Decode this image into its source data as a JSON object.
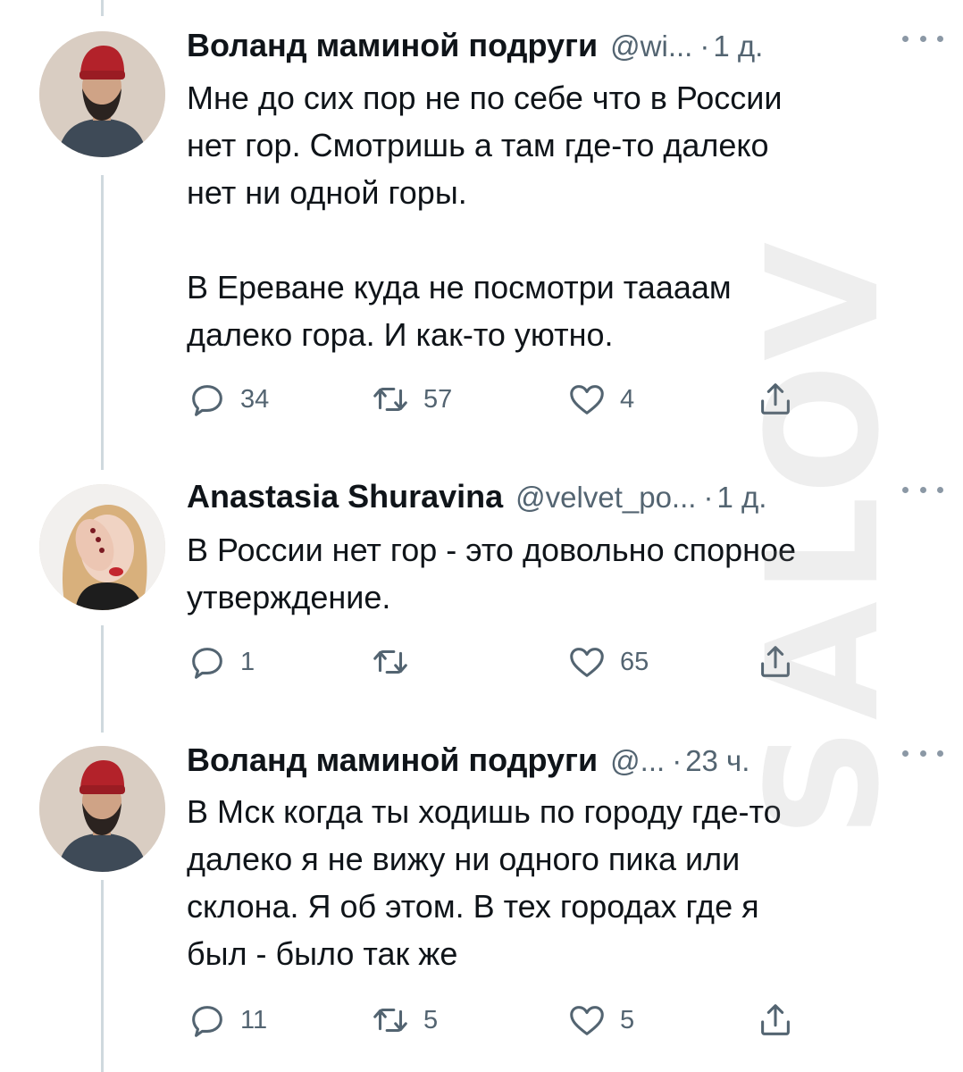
{
  "watermark": "SALOV",
  "tweets": [
    {
      "author": "Воланд маминой подруги",
      "handle": "@wi...",
      "time": "1 д.",
      "text": "Мне до сих пор не по себе что в России\nнет гор. Смотришь а там где-то далеко\nнет ни одной горы.\n\nВ Ереване куда не посмотри таааам\nдалеко гора. И как-то уютно.",
      "replies": "34",
      "retweets": "57",
      "likes": "4"
    },
    {
      "author": "Anastasia Shuravina",
      "handle": "@velvet_po...",
      "time": "1 д.",
      "text": "В России нет гор - это довольно спорное\nутверждение.",
      "replies": "1",
      "retweets": "",
      "likes": "65"
    },
    {
      "author": "Воланд маминой подруги",
      "handle": "@...",
      "time": "23 ч.",
      "text": "В Мск когда ты ходишь по городу где-то\nдалеко я не вижу ни одного пика или\nсклона. Я об этом. В тех городах где я\nбыл - было так же",
      "replies": "11",
      "retweets": "5",
      "likes": "5"
    }
  ],
  "icons": {
    "reply": "reply-icon",
    "retweet": "retweet-icon",
    "like": "heart-icon",
    "share": "share-icon",
    "more": "more-icon"
  },
  "colors": {
    "text": "#0f1419",
    "secondary": "#536471",
    "thread_line": "#cfd9de"
  }
}
